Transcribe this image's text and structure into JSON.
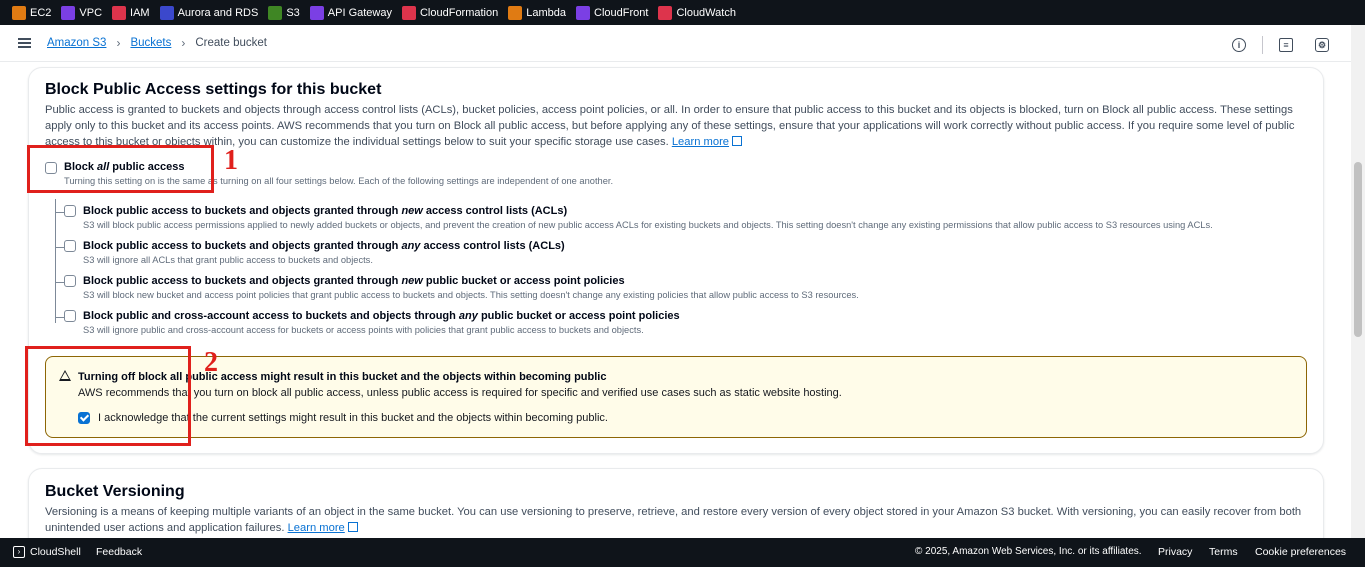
{
  "topbar": {
    "services": [
      {
        "label": "EC2",
        "icon": "ec2-icon",
        "color": "#e07b13"
      },
      {
        "label": "VPC",
        "icon": "vpc-icon",
        "color": "#7b3fe4"
      },
      {
        "label": "IAM",
        "icon": "iam-icon",
        "color": "#dd344c"
      },
      {
        "label": "Aurora and RDS",
        "icon": "rds-icon",
        "color": "#3b48cc"
      },
      {
        "label": "S3",
        "icon": "s3-icon",
        "color": "#3f8624"
      },
      {
        "label": "API Gateway",
        "icon": "api-gateway-icon",
        "color": "#7b3fe4"
      },
      {
        "label": "CloudFormation",
        "icon": "cloudformation-icon",
        "color": "#dd344c"
      },
      {
        "label": "Lambda",
        "icon": "lambda-icon",
        "color": "#e07b13"
      },
      {
        "label": "CloudFront",
        "icon": "cloudfront-icon",
        "color": "#7b3fe4"
      },
      {
        "label": "CloudWatch",
        "icon": "cloudwatch-icon",
        "color": "#dd344c"
      }
    ]
  },
  "breadcrumb": {
    "s3": "Amazon S3",
    "buckets": "Buckets",
    "current": "Create bucket"
  },
  "bpa": {
    "title": "Block Public Access settings for this bucket",
    "desc": "Public access is granted to buckets and objects through access control lists (ACLs), bucket policies, access point policies, or all. In order to ensure that public access to this bucket and its objects is blocked, turn on Block all public access. These settings apply only to this bucket and its access points. AWS recommends that you turn on Block all public access, but before applying any of these settings, ensure that your applications will work correctly without public access. If you require some level of public access to this bucket or objects within, you can customize the individual settings below to suit your specific storage use cases.",
    "learn_more": "Learn more",
    "block_all_pre": "Block ",
    "block_all_em": "all",
    "block_all_post": " public access",
    "block_all_desc": "Turning this setting on is the same as turning on all four settings below. Each of the following settings are independent of one another.",
    "block_all_checked": false,
    "options": [
      {
        "pre": "Block public access to buckets and objects granted through ",
        "em": "new",
        "post": " access control lists (ACLs)",
        "desc": "S3 will block public access permissions applied to newly added buckets or objects, and prevent the creation of new public access ACLs for existing buckets and objects. This setting doesn't change any existing permissions that allow public access to S3 resources using ACLs.",
        "checked": false
      },
      {
        "pre": "Block public access to buckets and objects granted through ",
        "em": "any",
        "post": " access control lists (ACLs)",
        "desc": "S3 will ignore all ACLs that grant public access to buckets and objects.",
        "checked": false
      },
      {
        "pre": "Block public access to buckets and objects granted through ",
        "em": "new",
        "post": " public bucket or access point policies",
        "desc": "S3 will block new bucket and access point policies that grant public access to buckets and objects. This setting doesn't change any existing policies that allow public access to S3 resources.",
        "checked": false
      },
      {
        "pre": "Block public and cross-account access to buckets and objects through ",
        "em": "any",
        "post": " public bucket or access point policies",
        "desc": "S3 will ignore public and cross-account access for buckets or access points with policies that grant public access to buckets and objects.",
        "checked": false
      }
    ],
    "warning_title": "Turning off block all public access might result in this bucket and the objects within becoming public",
    "warning_desc": "AWS recommends that you turn on block all public access, unless public access is required for specific and verified use cases such as static website hosting.",
    "ack_label": "I acknowledge that the current settings might result in this bucket and the objects within becoming public.",
    "ack_checked": true
  },
  "versioning": {
    "title": "Bucket Versioning",
    "desc": "Versioning is a means of keeping multiple variants of an object in the same bucket. You can use versioning to preserve, retrieve, and restore every version of every object stored in your Amazon S3 bucket. With versioning, you can easily recover from both unintended user actions and application failures.",
    "learn_more": "Learn more"
  },
  "annotations": {
    "one": "1",
    "two": "2",
    "color": "#e0201c"
  },
  "footer": {
    "cloudshell": "CloudShell",
    "feedback": "Feedback",
    "copyright": "© 2025, Amazon Web Services, Inc. or its affiliates.",
    "privacy": "Privacy",
    "terms": "Terms",
    "cookies": "Cookie preferences"
  }
}
